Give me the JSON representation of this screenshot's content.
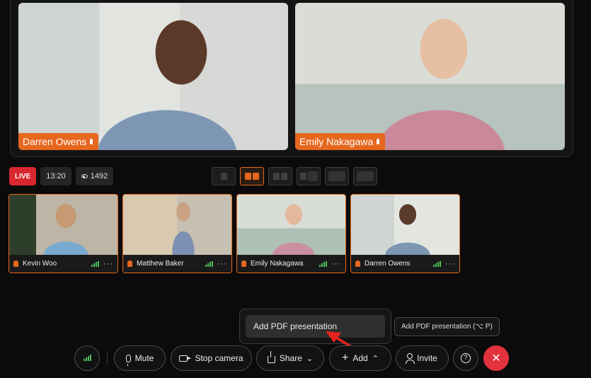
{
  "stage": {
    "participants": [
      {
        "name": "Darren Owens"
      },
      {
        "name": "Emily Nakagawa"
      }
    ]
  },
  "status": {
    "live": "LIVE",
    "duration": "13:20",
    "viewers": "1492"
  },
  "thumbnails": [
    {
      "name": "Kevin Woo"
    },
    {
      "name": "Matthew Baker"
    },
    {
      "name": "Emily Nakagawa"
    },
    {
      "name": "Darren Owens"
    }
  ],
  "popup": {
    "item": "Add PDF presentation"
  },
  "tooltip": {
    "text": "Add PDF presentation (⌥ P)"
  },
  "controls": {
    "mute": "Mute",
    "stop_camera": "Stop camera",
    "share": "Share",
    "add": "Add",
    "invite": "Invite"
  },
  "colors": {
    "accent": "#e6671e",
    "live": "#d8272f",
    "end_call": "#e2323d",
    "signal": "#4fbf5a",
    "annotation_arrow": "#e8231f"
  }
}
